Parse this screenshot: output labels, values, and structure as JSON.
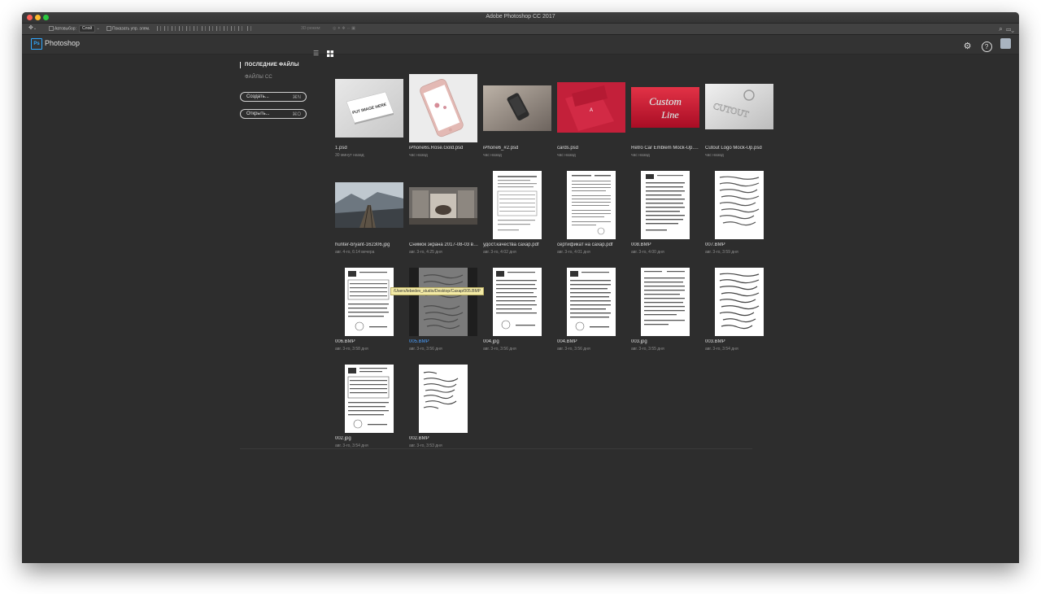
{
  "window": {
    "title": "Adobe Photoshop CC 2017"
  },
  "options_bar": {
    "autoselect_label": "Автовыбор:",
    "autoselect_value": "Слой",
    "show_controls_label": "Показать упр. элем.",
    "mode_3d_label": "3D-режим:"
  },
  "app_bar": {
    "app_name": "Photoshop",
    "logo_text": "Ps"
  },
  "sidebar": {
    "recent_label": "ПОСЛЕДНИЕ ФАЙЛЫ",
    "cc_files_label": "ФАЙЛЫ CC",
    "create_label": "Создать...",
    "create_shortcut": "⌘N",
    "open_label": "Открыть...",
    "open_shortcut": "⌘O"
  },
  "tooltip": "/Users/lebedev_studio/Desktop/Сахар/005.BMP",
  "files": [
    {
      "name": "1.psd",
      "date": "30 минут назад"
    },
    {
      "name": "iPhone6s.Rose.Gold.psd",
      "date": "час назад"
    },
    {
      "name": "iPhone6_#2.psd",
      "date": "час назад"
    },
    {
      "name": "cards.psd",
      "date": "час назад"
    },
    {
      "name": "Retro Car Emblem Mock-Up.psd",
      "date": "час назад"
    },
    {
      "name": "Cutout Logo Mock-Up.psd",
      "date": "час назад"
    },
    {
      "name": "hunter-bryant-162306.jpg",
      "date": "авг. 4-го, 6:14 вечера"
    },
    {
      "name": "Снимок экрана 2017-08-03 в 4.25.png",
      "date": "авг. 3-го, 4:25 дня"
    },
    {
      "name": "удост.качества сахар.pdf",
      "date": "авг. 3-го, 4:02 дня"
    },
    {
      "name": "сертификат на сахар.pdf",
      "date": "авг. 3-го, 4:01 дня"
    },
    {
      "name": "008.BMP",
      "date": "авг. 3-го, 4:00 дня"
    },
    {
      "name": "007.BMP",
      "date": "авг. 3-го, 3:59 дня"
    },
    {
      "name": "006.BMP",
      "date": "авг. 3-го, 3:58 дня"
    },
    {
      "name": "005.BMP",
      "date": "авг. 3-го, 3:56 дня"
    },
    {
      "name": "004.jpg",
      "date": "авг. 3-го, 3:56 дня"
    },
    {
      "name": "004.BMP",
      "date": "авг. 3-го, 3:56 дня"
    },
    {
      "name": "003.jpg",
      "date": "авг. 3-го, 3:55 дня"
    },
    {
      "name": "003.BMP",
      "date": "авг. 3-го, 3:54 дня"
    },
    {
      "name": "002.jpg",
      "date": "авг. 3-го, 3:54 дня"
    },
    {
      "name": "002.BMP",
      "date": "авг. 3-го, 3:53 дня"
    }
  ]
}
